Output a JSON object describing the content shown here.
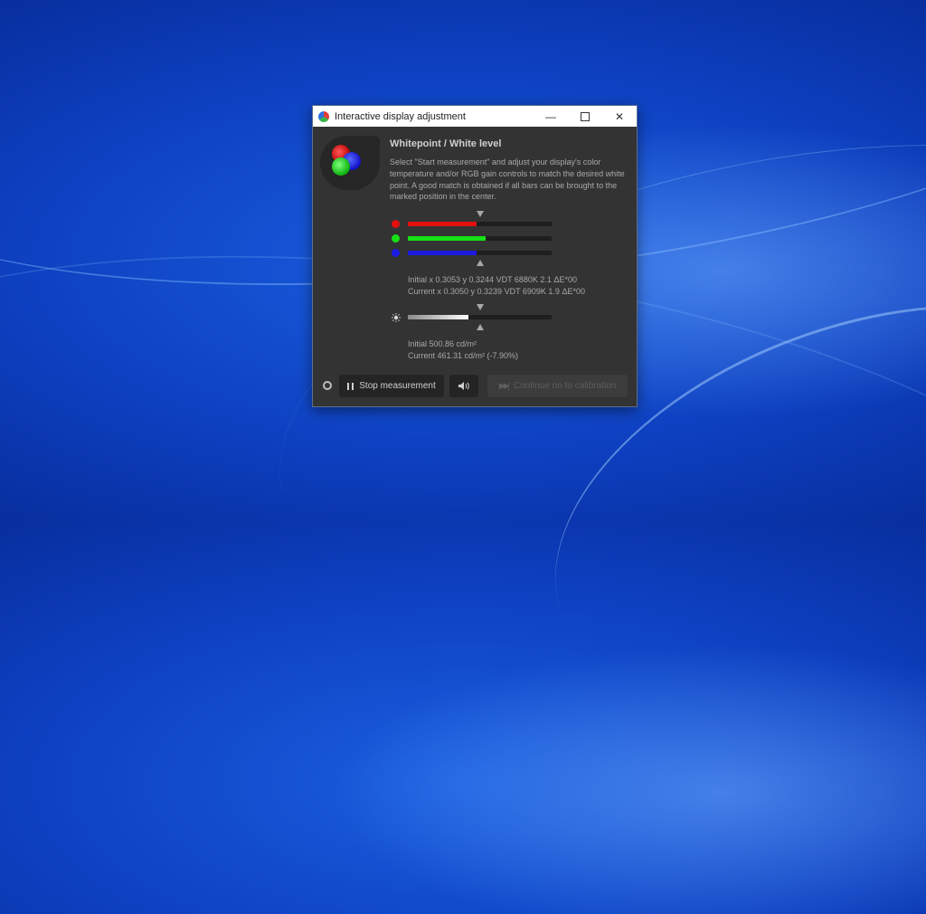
{
  "window": {
    "title": "Interactive display adjustment",
    "controls": {
      "minimize": "—",
      "close": "✕"
    }
  },
  "content": {
    "heading": "Whitepoint / White level",
    "description": "Select \"Start measurement\" and adjust your display's color temperature and/or RGB gain controls to match the desired white point. A good match is obtained if all bars can be brought to the marked position in the center."
  },
  "rgb_bars": [
    {
      "channel": "red",
      "color": "#e31010",
      "level": 0.48
    },
    {
      "channel": "green",
      "color": "#16e016",
      "level": 0.54
    },
    {
      "channel": "blue",
      "color": "#1a1ae0",
      "level": 0.48
    }
  ],
  "whitepoint_readout": {
    "initial": "Initial x 0.3053 y 0.3244 VDT 6880K 2.1 ΔE*00",
    "current": "Current x 0.3050 y 0.3239 VDT 6909K 1.9 ΔE*00"
  },
  "luminance_bar": {
    "level": 0.42,
    "icon": "brightness-icon"
  },
  "luminance_readout": {
    "initial": "Initial 500.86 cd/m²",
    "current": "Current 461.31 cd/m² (-7.90%)"
  },
  "buttons": {
    "stop": "Stop measurement",
    "continue": "Continue on to calibration"
  }
}
